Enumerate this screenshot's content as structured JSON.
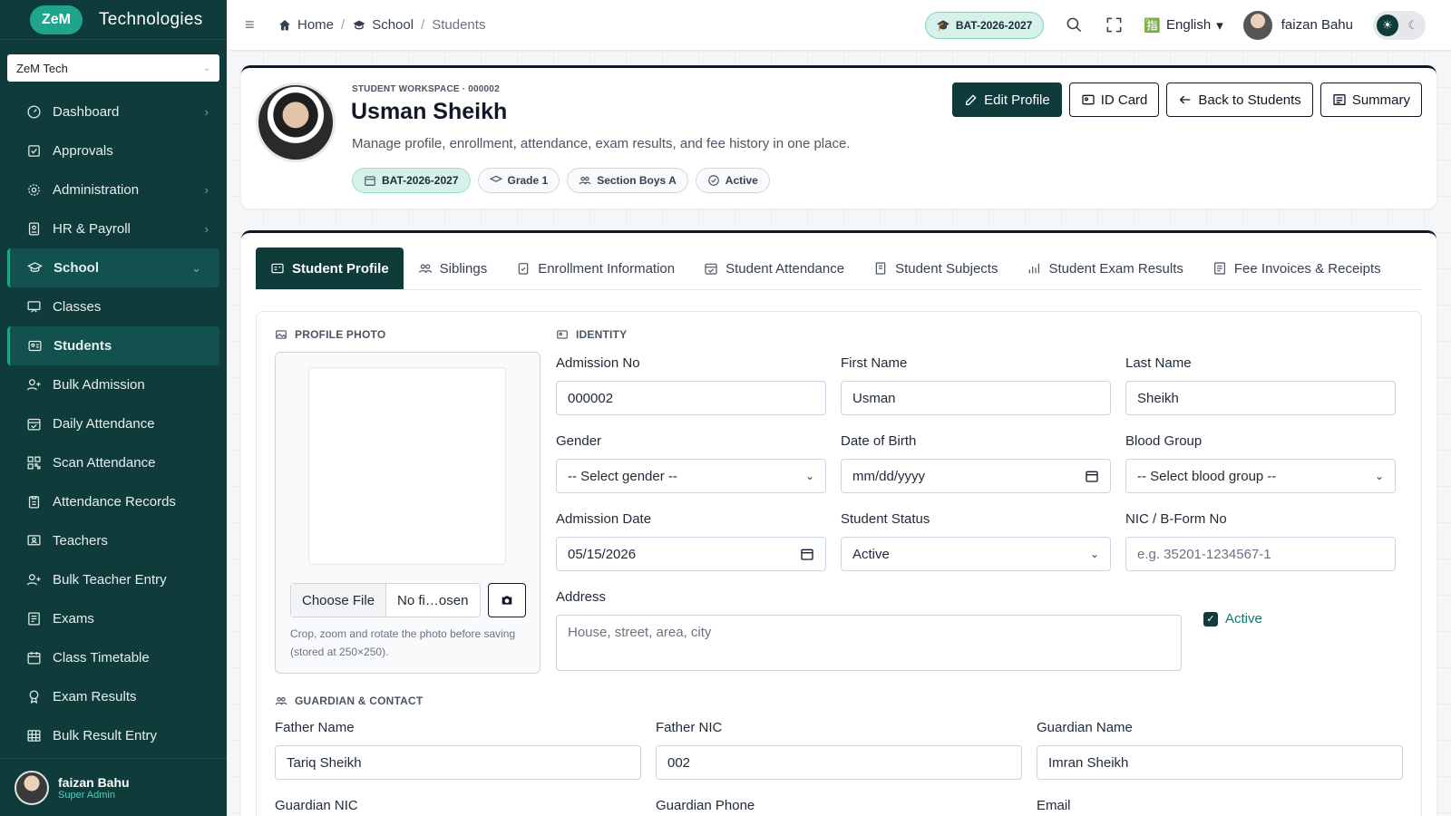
{
  "brand": {
    "logo": "ZeM",
    "name": "Technologies"
  },
  "org_select": {
    "value": "ZeM Tech"
  },
  "sidebar": {
    "items": [
      {
        "label": "Dashboard",
        "icon": "gauge-icon",
        "arrow": "›"
      },
      {
        "label": "Approvals",
        "icon": "check-square-icon",
        "arrow": ""
      },
      {
        "label": "Administration",
        "icon": "gear-icon",
        "arrow": "›"
      },
      {
        "label": "HR & Payroll",
        "icon": "badge-icon",
        "arrow": "›"
      },
      {
        "label": "School",
        "icon": "graduation-cap-icon",
        "arrow": "⌄"
      },
      {
        "label": "Classes",
        "icon": "chalkboard-icon",
        "arrow": ""
      },
      {
        "label": "Students",
        "icon": "id-card-icon",
        "arrow": ""
      },
      {
        "label": "Bulk Admission",
        "icon": "user-plus-icon",
        "arrow": ""
      },
      {
        "label": "Daily Attendance",
        "icon": "calendar-check-icon",
        "arrow": ""
      },
      {
        "label": "Scan Attendance",
        "icon": "qr-code-icon",
        "arrow": ""
      },
      {
        "label": "Attendance Records",
        "icon": "clipboard-icon",
        "arrow": ""
      },
      {
        "label": "Teachers",
        "icon": "teacher-icon",
        "arrow": ""
      },
      {
        "label": "Bulk Teacher Entry",
        "icon": "user-plus-icon",
        "arrow": ""
      },
      {
        "label": "Exams",
        "icon": "exam-icon",
        "arrow": ""
      },
      {
        "label": "Class Timetable",
        "icon": "calendar-icon",
        "arrow": ""
      },
      {
        "label": "Exam Results",
        "icon": "award-icon",
        "arrow": ""
      },
      {
        "label": "Bulk Result Entry",
        "icon": "table-icon",
        "arrow": ""
      }
    ],
    "footer": {
      "name": "faizan Bahu",
      "role": "Super Admin"
    }
  },
  "topbar": {
    "breadcrumbs": [
      "Home",
      "School",
      "Students"
    ],
    "session": "BAT-2026-2027",
    "language": "English",
    "user": "faizan Bahu"
  },
  "header": {
    "workspace_label": "STUDENT WORKSPACE · 000002",
    "name": "Usman Sheikh",
    "description": "Manage profile, enrollment, attendance, exam results, and fee history in one place.",
    "chips": [
      "BAT-2026-2027",
      "Grade 1",
      "Section Boys A",
      "Active"
    ],
    "actions": [
      "Edit Profile",
      "ID Card",
      "Back to Students",
      "Summary"
    ]
  },
  "tabs": [
    {
      "label": "Student Profile",
      "icon": "id-card-icon"
    },
    {
      "label": "Siblings",
      "icon": "users-icon"
    },
    {
      "label": "Enrollment Information",
      "icon": "clipboard-check-icon"
    },
    {
      "label": "Student Attendance",
      "icon": "calendar-check-icon"
    },
    {
      "label": "Student Subjects",
      "icon": "book-icon"
    },
    {
      "label": "Student Exam Results",
      "icon": "bar-chart-icon"
    },
    {
      "label": "Fee Invoices & Receipts",
      "icon": "receipt-icon"
    }
  ],
  "profile_photo": {
    "title": "PROFILE PHOTO",
    "choose_file": "Choose File",
    "file_name": "No fi…osen",
    "hint": "Crop, zoom and rotate the photo before saving (stored at 250×250)."
  },
  "identity": {
    "title": "IDENTITY",
    "admission_no": {
      "label": "Admission No",
      "value": "000002"
    },
    "first_name": {
      "label": "First Name",
      "value": "Usman"
    },
    "last_name": {
      "label": "Last Name",
      "value": "Sheikh"
    },
    "gender": {
      "label": "Gender",
      "value": "-- Select gender --"
    },
    "dob": {
      "label": "Date of Birth",
      "value": "mm/dd/yyyy"
    },
    "blood_group": {
      "label": "Blood Group",
      "value": "-- Select blood group --"
    },
    "admission_date": {
      "label": "Admission Date",
      "value": "05/15/2026"
    },
    "student_status": {
      "label": "Student Status",
      "value": "Active"
    },
    "nic": {
      "label": "NIC / B-Form No",
      "placeholder": "e.g. 35201-1234567-1"
    },
    "address": {
      "label": "Address",
      "placeholder": "House, street, area, city"
    },
    "active_checkbox": "Active"
  },
  "guardian": {
    "title": "GUARDIAN & CONTACT",
    "father_name": {
      "label": "Father Name",
      "value": "Tariq Sheikh"
    },
    "father_nic": {
      "label": "Father NIC",
      "value": "002"
    },
    "guardian_name": {
      "label": "Guardian Name",
      "value": "Imran Sheikh"
    },
    "guardian_nic": {
      "label": "Guardian NIC"
    },
    "guardian_phone": {
      "label": "Guardian Phone"
    },
    "email": {
      "label": "Email"
    }
  }
}
